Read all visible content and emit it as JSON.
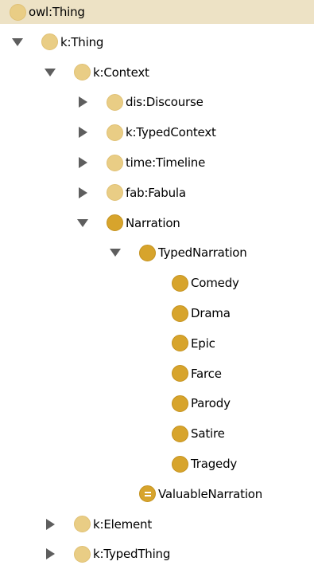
{
  "tree": {
    "rows": [
      {
        "label": "owl:Thing",
        "depth": 0,
        "twisty": "none",
        "icon": "primitive-class-icon",
        "selected": true
      },
      {
        "label": "k:Thing",
        "depth": 1,
        "twisty": "expanded",
        "icon": "primitive-class-icon"
      },
      {
        "label": "k:Context",
        "depth": 2,
        "twisty": "expanded",
        "icon": "primitive-class-icon"
      },
      {
        "label": "dis:Discourse",
        "depth": 3,
        "twisty": "collapsed",
        "icon": "primitive-class-icon"
      },
      {
        "label": "k:TypedContext",
        "depth": 3,
        "twisty": "collapsed",
        "icon": "primitive-class-icon"
      },
      {
        "label": "time:Timeline",
        "depth": 3,
        "twisty": "collapsed",
        "icon": "primitive-class-icon"
      },
      {
        "label": "fab:Fabula",
        "depth": 3,
        "twisty": "collapsed",
        "icon": "primitive-class-icon"
      },
      {
        "label": "Narration",
        "depth": 3,
        "twisty": "expanded",
        "icon": "defined-class-icon"
      },
      {
        "label": "TypedNarration",
        "depth": 4,
        "twisty": "expanded",
        "icon": "defined-class-icon"
      },
      {
        "label": "Comedy",
        "depth": 5,
        "twisty": "none",
        "icon": "defined-class-icon"
      },
      {
        "label": "Drama",
        "depth": 5,
        "twisty": "none",
        "icon": "defined-class-icon"
      },
      {
        "label": "Epic",
        "depth": 5,
        "twisty": "none",
        "icon": "defined-class-icon"
      },
      {
        "label": "Farce",
        "depth": 5,
        "twisty": "none",
        "icon": "defined-class-icon"
      },
      {
        "label": "Parody",
        "depth": 5,
        "twisty": "none",
        "icon": "defined-class-icon"
      },
      {
        "label": "Satire",
        "depth": 5,
        "twisty": "none",
        "icon": "defined-class-icon"
      },
      {
        "label": "Tragedy",
        "depth": 5,
        "twisty": "none",
        "icon": "defined-class-icon"
      },
      {
        "label": "ValuableNarration",
        "depth": 4,
        "twisty": "none",
        "icon": "equivalent-class-icon"
      },
      {
        "label": "k:Element",
        "depth": 2,
        "twisty": "collapsed",
        "icon": "primitive-class-icon"
      },
      {
        "label": "k:TypedThing",
        "depth": 2,
        "twisty": "collapsed",
        "icon": "primitive-class-icon"
      }
    ]
  },
  "colors": {
    "selection": "#ede2c5",
    "primitive_class": "#e9cd85",
    "defined_class": "#d7a42c",
    "twisty": "#5e5e5e"
  }
}
